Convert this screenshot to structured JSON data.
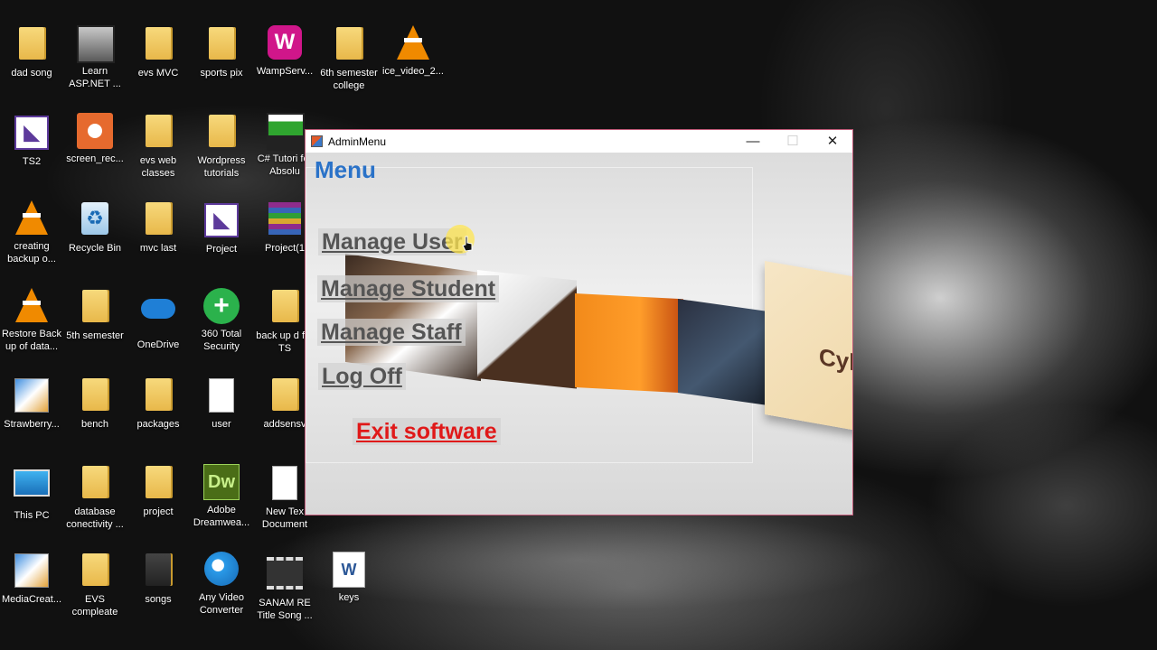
{
  "window": {
    "title": "AdminMenu",
    "minimize": "—",
    "maximize": "☐",
    "close": "✕"
  },
  "menu": {
    "heading": "Menu",
    "items": [
      {
        "label": "Manage User"
      },
      {
        "label": "Manage Student"
      },
      {
        "label": "Manage Staff"
      },
      {
        "label": "Log Off"
      }
    ],
    "exit_label": "Exit software",
    "banner_text": "Cybe"
  },
  "desktop": {
    "icons": [
      {
        "label": "dad song",
        "icon": "folder-icon"
      },
      {
        "label": "Learn ASP.NET ...",
        "icon": "video-thumbnail-icon"
      },
      {
        "label": "evs MVC",
        "icon": "folder-icon"
      },
      {
        "label": "sports pix",
        "icon": "folder-icon"
      },
      {
        "label": "WampServ...",
        "icon": "wampserver-icon"
      },
      {
        "label": "6th semester college",
        "icon": "folder-icon"
      },
      {
        "label": "ice_video_2...",
        "icon": "vlc-icon"
      },
      {
        "label": "TS2",
        "icon": "visual-studio-icon"
      },
      {
        "label": "screen_rec...",
        "icon": "screen-recorder-icon"
      },
      {
        "label": "evs web classes",
        "icon": "folder-icon"
      },
      {
        "label": "Wordpress tutorials",
        "icon": "folder-icon"
      },
      {
        "label": "C# Tutori for Absolu",
        "icon": "video-thumbnail-icon"
      },
      {
        "label": "creating backup o...",
        "icon": "vlc-icon"
      },
      {
        "label": "Recycle Bin",
        "icon": "recycle-bin-icon"
      },
      {
        "label": "mvc last",
        "icon": "folder-icon"
      },
      {
        "label": "Project",
        "icon": "visual-studio-icon"
      },
      {
        "label": "Project(1",
        "icon": "winrar-icon"
      },
      {
        "label": "Restore Back up of data...",
        "icon": "vlc-icon"
      },
      {
        "label": "5th semester",
        "icon": "folder-icon"
      },
      {
        "label": "OneDrive",
        "icon": "onedrive-icon"
      },
      {
        "label": "360 Total Security",
        "icon": "security-icon"
      },
      {
        "label": "back up d for TS",
        "icon": "folder-icon"
      },
      {
        "label": "Strawberry...",
        "icon": "setup-icon"
      },
      {
        "label": "bench",
        "icon": "folder-icon"
      },
      {
        "label": "packages",
        "icon": "folder-icon"
      },
      {
        "label": "user",
        "icon": "document-icon"
      },
      {
        "label": "addsensv",
        "icon": "folder-icon"
      },
      {
        "label": "This PC",
        "icon": "computer-icon"
      },
      {
        "label": "database conectivity ...",
        "icon": "folder-icon"
      },
      {
        "label": "project",
        "icon": "folder-icon"
      },
      {
        "label": "Adobe Dreamwea...",
        "icon": "dreamweaver-icon"
      },
      {
        "label": "New Tex Document",
        "icon": "document-icon"
      },
      {
        "label": "MediaCreat...",
        "icon": "setup-icon"
      },
      {
        "label": "EVS compleate",
        "icon": "folder-icon"
      },
      {
        "label": "songs",
        "icon": "folder-icon"
      },
      {
        "label": "Any Video Converter",
        "icon": "video-converter-icon"
      },
      {
        "label": "SANAM RE Title Song ...",
        "icon": "film-icon"
      },
      {
        "label": "keys",
        "icon": "word-icon"
      }
    ]
  }
}
